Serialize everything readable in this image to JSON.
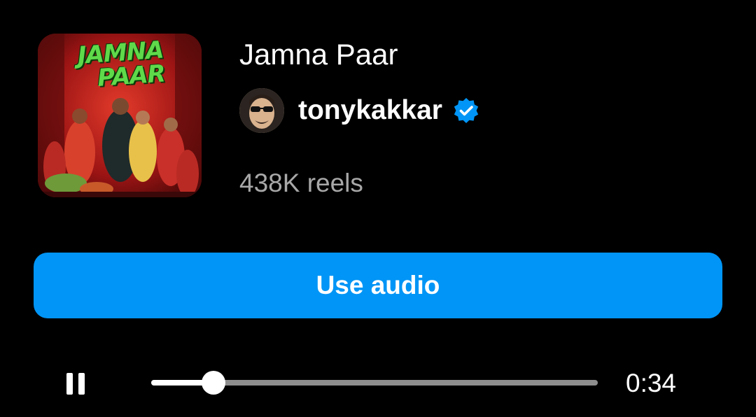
{
  "track": {
    "title": "Jamna Paar",
    "cover_art_text": [
      "JAMNA",
      "PAAR"
    ],
    "artist": "tonykakkar",
    "artist_verified": true,
    "reel_count": "438K reels"
  },
  "actions": {
    "use_audio_label": "Use audio"
  },
  "player": {
    "state": "playing",
    "progress_fraction": 0.14,
    "time_label": "0:34"
  },
  "colors": {
    "background": "#000000",
    "accent": "#0095f6",
    "secondary_text": "#a8a8a8",
    "verified_badge": "#0095f6",
    "scrubber_track": "#8e8e8e"
  },
  "icons": {
    "pause": "pause-icon",
    "verified": "verified-badge-icon"
  }
}
